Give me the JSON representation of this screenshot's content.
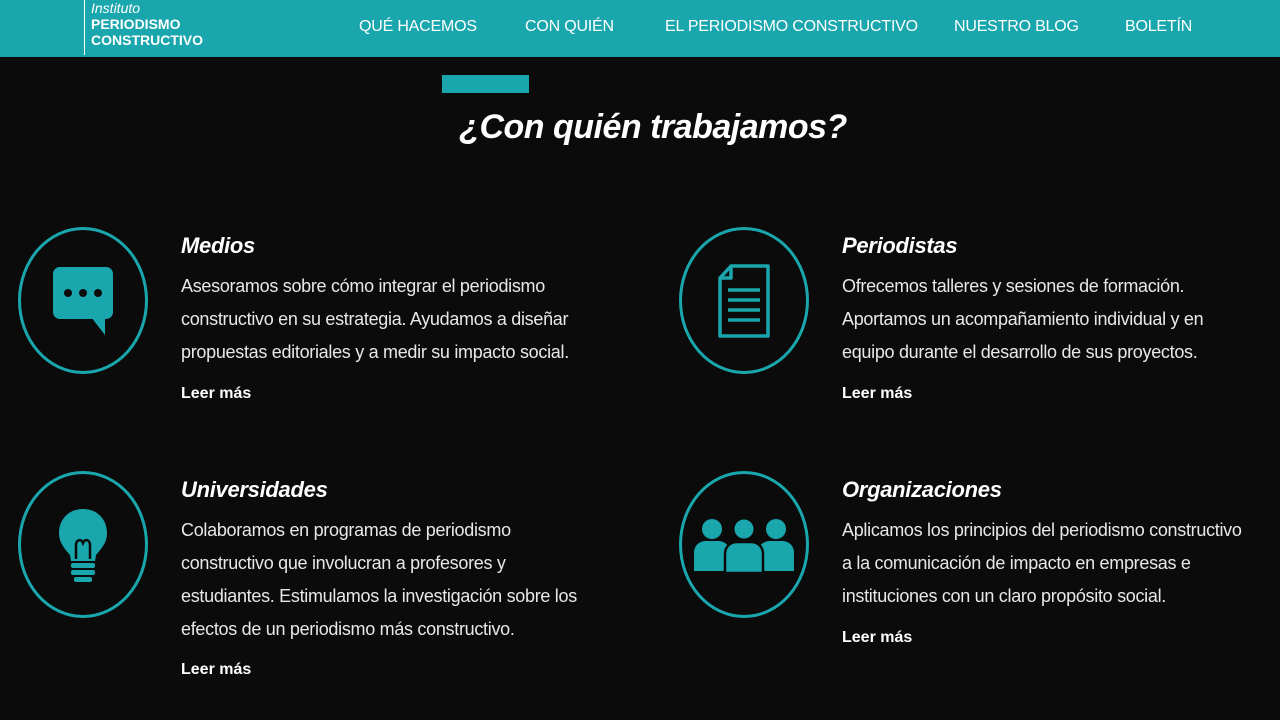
{
  "header": {
    "logo": {
      "line1": "Instituto",
      "line2": "PERIODISMO",
      "line3": "CONSTRUCTIVO"
    },
    "nav": [
      {
        "label": "QUÉ HACEMOS"
      },
      {
        "label": "CON QUIÉN"
      },
      {
        "label": "EL PERIODISMO CONSTRUCTIVO"
      },
      {
        "label": "NUESTRO BLOG"
      },
      {
        "label": "BOLETÍN"
      }
    ]
  },
  "section": {
    "title": "¿Con quién trabajamos?"
  },
  "cards": [
    {
      "icon": "chat-bubble-icon",
      "title": "Medios",
      "lines": [
        "Asesoramos sobre cómo integrar el periodismo",
        "constructivo en su estrategia. Ayudamos a diseñar",
        "propuestas editoriales y a medir su impacto social."
      ],
      "link": "Leer más"
    },
    {
      "icon": "document-icon",
      "title": "Periodistas",
      "lines": [
        "Ofrecemos talleres y sesiones de formación.",
        "Aportamos un acompañamiento individual y en",
        "equipo durante el desarrollo de sus proyectos."
      ],
      "link": "Leer más"
    },
    {
      "icon": "lightbulb-icon",
      "title": "Universidades",
      "lines": [
        "Colaboramos en programas de periodismo",
        "constructivo que involucran a profesores y",
        "estudiantes. Estimulamos la investigación sobre los",
        "efectos de un periodismo más constructivo."
      ],
      "link": "Leer más"
    },
    {
      "icon": "people-group-icon",
      "title": "Organizaciones",
      "lines": [
        "Aplicamos los principios del periodismo constructivo",
        "a la comunicación de impacto en empresas e",
        "instituciones con un claro propósito social."
      ],
      "link": "Leer más"
    }
  ],
  "colors": {
    "accent": "#1aa6ad",
    "background": "#0b0b0b",
    "text": "#ffffff"
  }
}
